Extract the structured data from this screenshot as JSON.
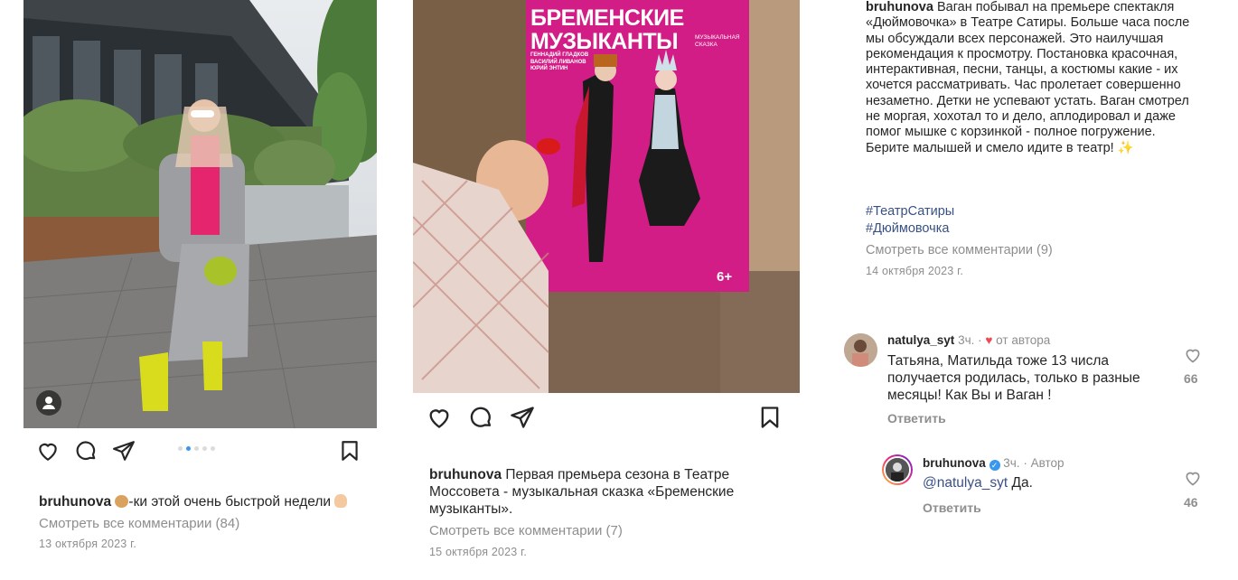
{
  "colors": {
    "link": "#385185",
    "muted": "#8e8e8e",
    "heart": "#ed4956",
    "verified": "#3897f0",
    "poster_pink": "#d21d86"
  },
  "post1": {
    "username": "bruhunova",
    "caption": "-ки этой очень быстрой недели",
    "view_comments": "Смотреть все комментарии (84)",
    "date": "13 октября 2023 г.",
    "carousel_dots": 5,
    "carousel_active": 1,
    "icons": [
      "heart-icon",
      "comment-icon",
      "share-icon",
      "bookmark-icon",
      "user-tag-icon"
    ]
  },
  "post2": {
    "poster_title_1": "БРЕМЕНСКИЕ",
    "poster_title_2": "МУЗЫКАНТЫ",
    "poster_subtitle": "МУЗЫКАЛЬНАЯ СКАЗКА",
    "poster_credits": [
      "ГЕННАДИЙ ГЛАДКОВ",
      "ВАСИЛИЙ ЛИВАНОВ",
      "ЮРИЙ ЭНТИН"
    ],
    "poster_age": "6+",
    "username": "bruhunova",
    "caption": "Первая премьера сезона в Театре Моссовета - музыкальная сказка «Бременские музыканты».",
    "view_comments": "Смотреть все комментарии (7)",
    "date": "15 октября 2023 г."
  },
  "post3": {
    "username": "bruhunova",
    "caption": "Ваган побывал на премьере спектакля «Дюймовочка» в Театре Сатиры. Больше часа после мы обсуждали всех персонажей. Это наилучшая рекомендация к просмотру. Постановка красочная, интерактивная, песни, танцы, а костюмы какие - их хочется рассматривать. Час пролетает совершенно незаметно. Детки не успевают устать. Ваган смотрел не моргая, хохотал то и дело, аплодировал и даже помог мышке с корзинкой - полное погружение. Берите малышей и смело идите в театр!",
    "hashtags": [
      "#ТеатрСатиры",
      "#Дюймовочка"
    ],
    "view_comments": "Смотреть все комментарии (9)",
    "date": "14 октября 2023 г.",
    "comments": [
      {
        "username": "natulya_syt",
        "time": "3ч.",
        "author_badge": "от автора",
        "text": "Татьяна, Матильда тоже 13 числа получается родилась, только в разные месяцы! Как Вы и Ваган !",
        "reply": "Ответить",
        "likes": "66"
      },
      {
        "username": "bruhunova",
        "time": "3ч.",
        "author_badge": "Автор",
        "mention": "@natulya_syt",
        "text": "Да.",
        "reply": "Ответить",
        "likes": "46"
      }
    ]
  }
}
